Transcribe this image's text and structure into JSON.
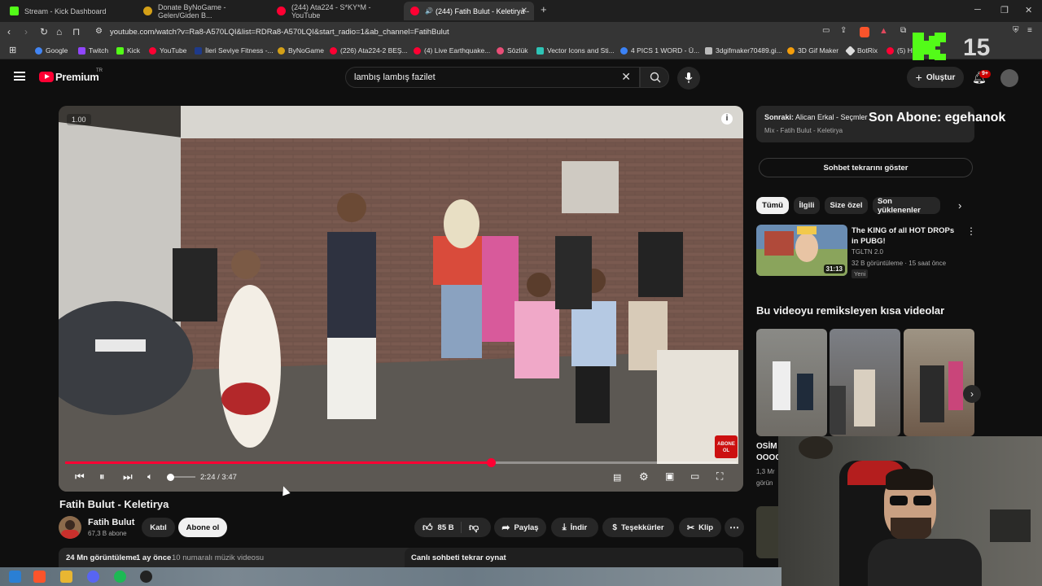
{
  "browser": {
    "tabs": [
      {
        "label": "Stream - Kick Dashboard",
        "color": "#53fc18"
      },
      {
        "label": "Donate ByNoGame - Gelen/Giden B...",
        "color": "#d4a017"
      },
      {
        "label": "(244) Ata224 - S*KY*M - YouTube",
        "color": "#ff0033"
      },
      {
        "label": "(244) Fatih Bulut - Keletirya -",
        "color": "#ff0033"
      }
    ],
    "new_tab": "+",
    "url": "youtube.com/watch?v=Ra8-A570LQI&list=RDRa8-A570LQI&start_radio=1&ab_channel=FatihBulut",
    "bookmarks": [
      {
        "label": "Google",
        "color": "#4285f4"
      },
      {
        "label": "Twitch",
        "color": "#9146ff"
      },
      {
        "label": "Kick",
        "color": "#53fc18"
      },
      {
        "label": "YouTube",
        "color": "#ff0033"
      },
      {
        "label": "İleri Seviye Fitness -...",
        "color": "#1e3a8a"
      },
      {
        "label": "ByNoGame",
        "color": "#d4a017"
      },
      {
        "label": "(226) Ata224-2 BEŞ...",
        "color": "#ff0033"
      },
      {
        "label": "(4) Live Earthquake...",
        "color": "#ff0033"
      },
      {
        "label": "Sözlük",
        "color": "#e94e77"
      },
      {
        "label": "Vector Icons and Sti...",
        "color": "#2ec4b6"
      },
      {
        "label": "4 PICS 1 WORD - Ü...",
        "color": "#3b82f6"
      },
      {
        "label": "3dgifmaker70489.gi...",
        "color": "#bbbbbb"
      },
      {
        "label": "3D Gif Maker",
        "color": "#f59e0b"
      },
      {
        "label": "BotRix",
        "color": "#dddddd"
      },
      {
        "label": "(5) Hype",
        "color": "#ff0033"
      }
    ]
  },
  "overlay": {
    "kick_logo": "K",
    "viewers": "15",
    "last_sub": "Son Abone: egehanok"
  },
  "youtube": {
    "logo": "Premium",
    "logo_region": "TR",
    "search_query": "lambış lambış fazilet",
    "create": "Oluştur",
    "notifications": "9+"
  },
  "video": {
    "speed_badge": "1.00",
    "time": "2:24 / 3:47",
    "progress": 0.634,
    "volume": 0.1,
    "sub_badge_top": "ABONE",
    "sub_badge_bottom": "OL",
    "title": "Fatih Bulut - Keletirya",
    "channel": "Fatih Bulut",
    "subscribers": "67,3 B abone",
    "join": "Katıl",
    "subscribe": "Abone ol",
    "likes": "85 B",
    "share": "Paylaş",
    "download": "İndir",
    "thanks": "Teşekkürler",
    "clip": "Klip",
    "views": "24 Mn görüntüleme",
    "age": "1 ay önce",
    "extra": "10 numaralı müzik videosu",
    "chat_replay": "Canlı sohbeti tekrar oynat"
  },
  "sidebar": {
    "next_label": "Sonraki:",
    "next_title": "Alican Erkal - Seçmler",
    "next_sub": "Mix - Fatih Bulut - Keletirya",
    "chat_button": "Sohbet tekrarını göster",
    "chips": [
      "Tümü",
      "İlgili",
      "Size özel",
      "Son yüklenenler"
    ],
    "rec": {
      "title": "The KING of all HOT DROPs in PUBG!",
      "channel": "TGLTN 2.0",
      "meta": "32 B görüntüleme · 15 saat önce",
      "badge": "Yeni",
      "duration": "31:13"
    },
    "shorts_heading": "Bu videoyu remiksleyen kısa videolar",
    "shorts_partial_title": "OSİM OOOC",
    "shorts_partial_meta": "1,3 Mr görün"
  },
  "colors": {
    "accent": "#ff0033",
    "bg": "#0f0f0f",
    "kick_green": "#53fc18"
  }
}
